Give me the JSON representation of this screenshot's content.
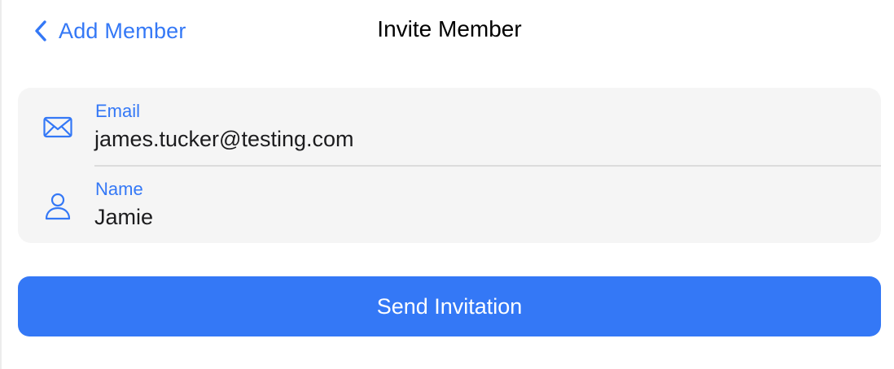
{
  "nav": {
    "back_label": "Add Member",
    "title": "Invite Member"
  },
  "form": {
    "email": {
      "label": "Email",
      "value": "james.tucker@testing.com",
      "icon": "envelope-icon"
    },
    "name": {
      "label": "Name",
      "value": "Jamie",
      "icon": "person-icon"
    }
  },
  "actions": {
    "send_label": "Send Invitation"
  },
  "colors": {
    "accent": "#3478f6",
    "card_background": "#f5f5f5",
    "text_primary": "#1c1c1e"
  }
}
